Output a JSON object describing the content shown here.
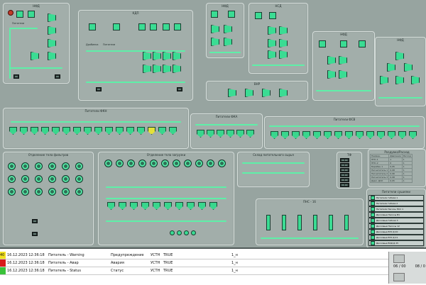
{
  "panels": {
    "p1": "НФД",
    "p2": "КДП",
    "p3": "НФД",
    "p4": "НСД",
    "p5": "НФД",
    "p6": "НФД",
    "p7": "ВНР",
    "sost": "Состав",
    "row1": "Питатели ФКН",
    "row2": "Питатели ФКА",
    "row3": "Питатели ФСВ",
    "left_mid": "Отделение тела фильтров",
    "mid_mid": "Отделение тела загрузки",
    "conv": "Склад питательного сырья",
    "tr": "ТФ",
    "tank": "ПНС - 16",
    "pres": "Раздувка/Расход",
    "legend_title": "Питатели сушилки"
  },
  "labels": {
    "pitateli": "Питатели",
    "drobilka": "Дробилка",
    "rfsp1": "РФссы ПГЕ",
    "rfsp2": "РФссы ПГЕ"
  },
  "legend": [
    "Питатели Гибкая 1",
    "Питатели Гибкая 2",
    "Питатели Насосы НСС 1",
    "Дисковые Насосы В1",
    "Дисковые Гибкая 3",
    "Дисковые Насосы 12",
    "Дисковые ЕХУ Д 20",
    "Дисковые ЕХУ Д 21",
    "Дисковые ВХД Д 25"
  ],
  "pressure_table": {
    "headers": [
      "Наимен.",
      "Давление",
      "Расход"
    ],
    "rows": [
      [
        "ПНС-1",
        "1",
        "1"
      ],
      [
        "ПНС-2",
        "0",
        "1"
      ],
      [
        "Барабан 1",
        "0,95",
        "1"
      ],
      [
        "Нагнетатель 1",
        "0,98",
        "1"
      ],
      [
        "Нагнетатель 2",
        "0,96",
        "1"
      ],
      [
        "Нагнетатель 3",
        "0,98",
        "1"
      ],
      [
        "Давл. ДСК",
        "0,95",
        "1"
      ]
    ]
  },
  "tf_rows": [
    "00.00",
    "00.00",
    "00.00",
    "00.00",
    "00.00",
    "00.00"
  ],
  "alarms": [
    {
      "sev": "40",
      "sevcolor": "#f2e11e",
      "time": "16.12.2023 12:36:18",
      "src": "Питатель - Warning",
      "type": "Предупреждение",
      "state": "УСТН",
      "val": "TRUE",
      "id": "1_н"
    },
    {
      "sev": "",
      "sevcolor": "#d81b1b",
      "time": "16.12.2023 12:36:18",
      "src": "Питатель - Авар",
      "type": "Авария",
      "state": "УСТН",
      "val": "TRUE",
      "id": "1_н"
    },
    {
      "sev": "",
      "sevcolor": "#3ac23a",
      "time": "16.12.2023 12:36:18",
      "src": "Питатель - Status",
      "type": "Статус",
      "state": "УСТН",
      "val": "TRUE",
      "id": "1_н"
    }
  ],
  "alarm_counter": "06 / 00",
  "alarm_counter2": "08 / 0"
}
